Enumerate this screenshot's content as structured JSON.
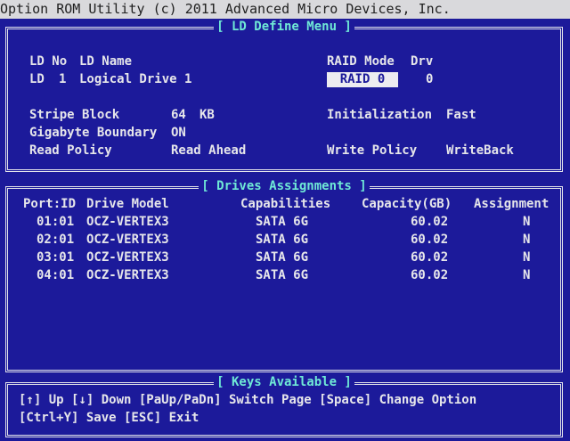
{
  "window": {
    "title": "Option ROM Utility (c) 2011 Advanced Micro Devices, Inc."
  },
  "ld_panel": {
    "title": "[ LD Define Menu ]",
    "ld_no_header": "LD No",
    "ld_name_header": "LD Name",
    "raid_mode_header": "RAID Mode",
    "drv_header": "Drv",
    "ld_label": "LD",
    "ld_no": "1",
    "ld_name": "Logical Drive 1",
    "raid_mode": "RAID 0",
    "drv": "0",
    "stripe_block_label": "Stripe Block",
    "stripe_block_value": "64",
    "stripe_block_unit": "KB",
    "initialization_label": "Initialization",
    "initialization_value": "Fast",
    "gigabyte_boundary_label": "Gigabyte Boundary",
    "gigabyte_boundary_value": "ON",
    "read_policy_label": "Read Policy",
    "read_policy_value": "Read Ahead",
    "write_policy_label": "Write Policy",
    "write_policy_value": "WriteBack"
  },
  "drives_panel": {
    "title": "[ Drives Assignments ]",
    "headers": {
      "port": "Port:ID",
      "model": "Drive Model",
      "caps": "Capabilities",
      "capacity": "Capacity(GB)",
      "assign": "Assignment"
    },
    "rows": [
      {
        "port": "01:01",
        "model": "OCZ-VERTEX3",
        "caps": "SATA 6G",
        "capacity": "60.02",
        "assign": "N"
      },
      {
        "port": "02:01",
        "model": "OCZ-VERTEX3",
        "caps": "SATA 6G",
        "capacity": "60.02",
        "assign": "N"
      },
      {
        "port": "03:01",
        "model": "OCZ-VERTEX3",
        "caps": "SATA 6G",
        "capacity": "60.02",
        "assign": "N"
      },
      {
        "port": "04:01",
        "model": "OCZ-VERTEX3",
        "caps": "SATA 6G",
        "capacity": "60.02",
        "assign": "N"
      }
    ]
  },
  "keys_panel": {
    "title": "[ Keys Available ]",
    "line1": "[↑] Up  [↓] Down  [PaUp/PaDn] Switch Page  [Space] Change Option",
    "line2": "[Ctrl+Y] Save  [ESC] Exit"
  },
  "colors": {
    "background": "#1c1a9a",
    "text": "#e6e6ea",
    "accent": "#6fe9d6"
  }
}
